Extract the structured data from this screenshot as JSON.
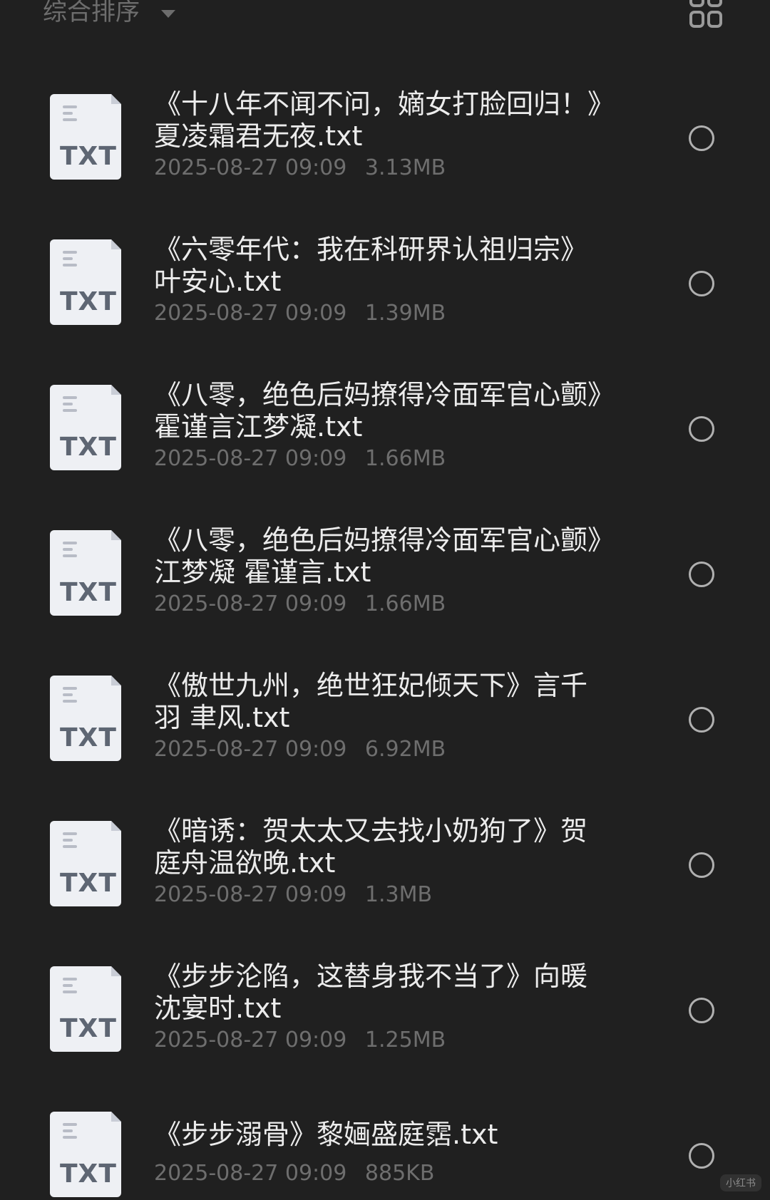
{
  "header": {
    "sort_label": "综合排序",
    "sort_icon": "caret-down-icon",
    "view_toggle_icon": "grid-view-icon"
  },
  "files": [
    {
      "name": "《十八年不闻不问，嫡女打脸回归！》夏凌霜君无夜.txt",
      "date": "2025-08-27 09:09",
      "size": "3.13MB",
      "icon_label": "TXT"
    },
    {
      "name": "《六零年代：我在科研界认祖归宗》叶安心.txt",
      "date": "2025-08-27 09:09",
      "size": "1.39MB",
      "icon_label": "TXT"
    },
    {
      "name": "《八零，绝色后妈撩得冷面军官心颤》霍谨言江梦凝.txt",
      "date": "2025-08-27 09:09",
      "size": "1.66MB",
      "icon_label": "TXT"
    },
    {
      "name": "《八零，绝色后妈撩得冷面军官心颤》江梦凝 霍谨言.txt",
      "date": "2025-08-27 09:09",
      "size": "1.66MB",
      "icon_label": "TXT"
    },
    {
      "name": "《傲世九州，绝世狂妃倾天下》言千羽 聿风.txt",
      "date": "2025-08-27 09:09",
      "size": "6.92MB",
      "icon_label": "TXT"
    },
    {
      "name": "《暗诱：贺太太又去找小奶狗了》贺庭舟温欲晚.txt",
      "date": "2025-08-27 09:09",
      "size": "1.3MB",
      "icon_label": "TXT"
    },
    {
      "name": "《步步沦陷，这替身我不当了》向暖沈宴时.txt",
      "date": "2025-08-27 09:09",
      "size": "1.25MB",
      "icon_label": "TXT"
    },
    {
      "name": "《步步溺骨》黎婳盛庭霑.txt",
      "date": "2025-08-27 09:09",
      "size": "885KB",
      "icon_label": "TXT"
    }
  ],
  "watermark": "小红书"
}
